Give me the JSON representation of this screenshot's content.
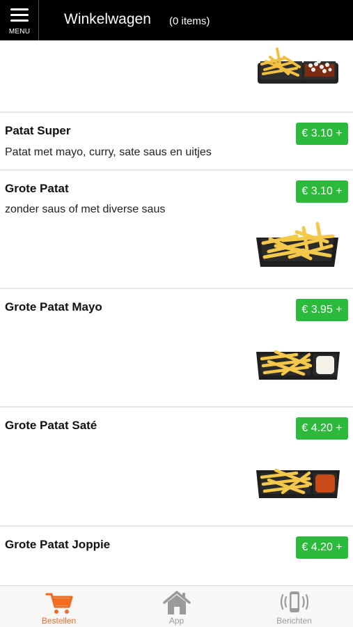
{
  "header": {
    "menu_label": "MENU",
    "title": "Winkelwagen",
    "items_count": "(0 items)"
  },
  "products": [
    {
      "name": "Patat Super",
      "description": "Patat met mayo, curry, sate saus en uitjes",
      "price": "€ 3.10 +"
    },
    {
      "name": "Grote Patat",
      "description": "zonder saus of met diverse saus",
      "price": "€ 3.10 +"
    },
    {
      "name": "Grote Patat Mayo",
      "description": "",
      "price": "€ 3.95 +"
    },
    {
      "name": "Grote Patat Saté",
      "description": "",
      "price": "€ 4.20 +"
    },
    {
      "name": "Grote Patat Joppie",
      "description": "",
      "price": "€ 4.20 +"
    }
  ],
  "tabs": [
    {
      "label": "Bestellen",
      "icon": "cart-icon",
      "active": true
    },
    {
      "label": "App",
      "icon": "home-icon",
      "active": false
    },
    {
      "label": "Berichten",
      "icon": "phone-vibrate-icon",
      "active": false
    }
  ],
  "colors": {
    "header_bg": "#000000",
    "price_button": "#2bba3c",
    "active_tab": "#f26b21",
    "inactive_tab": "#9a9a9a"
  }
}
